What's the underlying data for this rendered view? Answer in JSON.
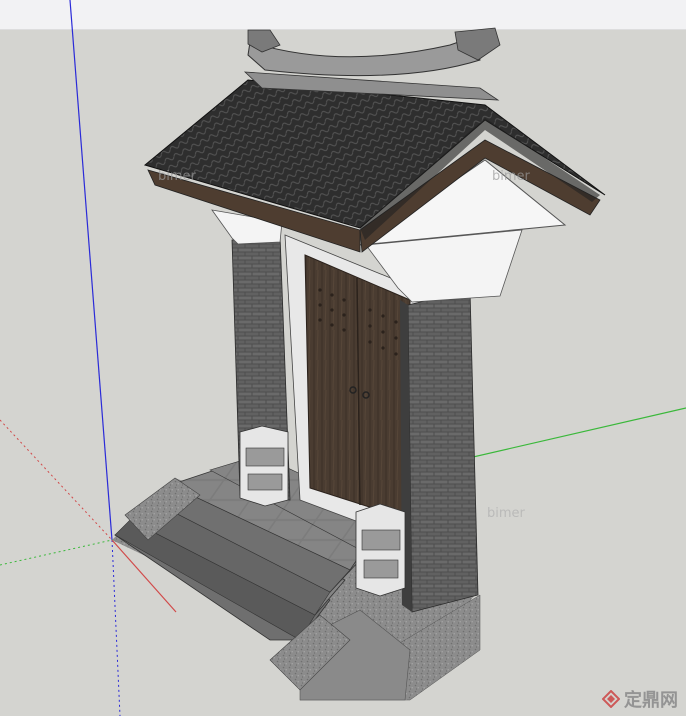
{
  "viewport": {
    "description_type": "3d-modeling-viewport",
    "sky_color": "#f2f2f4",
    "ground_color": "#d4d4d0",
    "axis_colors": {
      "red": "#d14a4a",
      "green": "#3ab83a",
      "blue": "#2a2ad8"
    }
  },
  "watermarks": {
    "scene_marks": [
      "bimer",
      "bimer",
      "bimer"
    ],
    "site_logo_text": "定鼎网"
  },
  "model": {
    "name": "chinese-gate-house",
    "roof_tile_color": "#2a2a2a",
    "brick_color": "#555555",
    "door_color": "#4b3d33",
    "plaster_color": "#f4f4f4",
    "stone_color": "#8a8a8a"
  }
}
